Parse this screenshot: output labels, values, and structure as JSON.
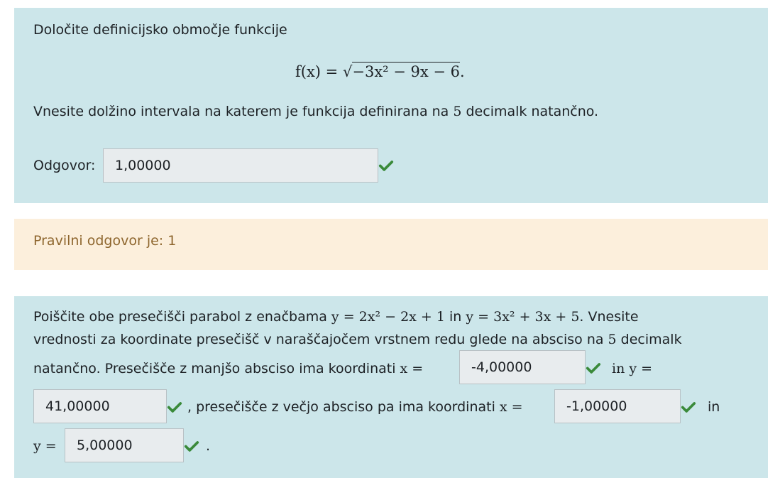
{
  "q1": {
    "prompt": "Določite definicijsko območje funkcije",
    "formula_lhs": "f(x) =",
    "formula_radicand": "−3x² − 9x − 6",
    "formula_end": ".",
    "instruction_a": "Vnesite dolžino intervala na katerem je funkcija definirana na ",
    "instruction_n": "5",
    "instruction_b": " decimalk natančno.",
    "answer_label": "Odgovor:",
    "answer_value": "1,00000"
  },
  "feedback1": {
    "text": "Pravilni odgovor je: 1"
  },
  "q2": {
    "line1_a": "Poiščite obe presečišči parabol z enačbama ",
    "eq1": "y = 2x² − 2x + 1",
    "line1_in": " in ",
    "eq2": "y = 3x² + 3x + 5",
    "line1_b": ". Vnesite",
    "line2_a": "vrednosti za koordinate presečišč v naraščajočem vrstnem redu glede na absciso na ",
    "line2_n": "5",
    "line2_b": " decimalk",
    "line3_a": "natančno. Presečišče z manjšo absciso ima koordinati ",
    "x_eq": "x =",
    "in_y": "in y =",
    "line4_mid": ", presečišče z večjo absciso pa ima koordinati ",
    "in_word": "in",
    "y_eq": "y =",
    "period": ".",
    "x1_value": "-4,00000",
    "y1_value": "41,00000",
    "x2_value": "-1,00000",
    "y2_value": "5,00000"
  },
  "colors": {
    "question_bg": "#cce6ea",
    "feedback_bg": "#fcefdc",
    "feedback_text": "#8e662e",
    "check_green": "#3a8a3a"
  }
}
